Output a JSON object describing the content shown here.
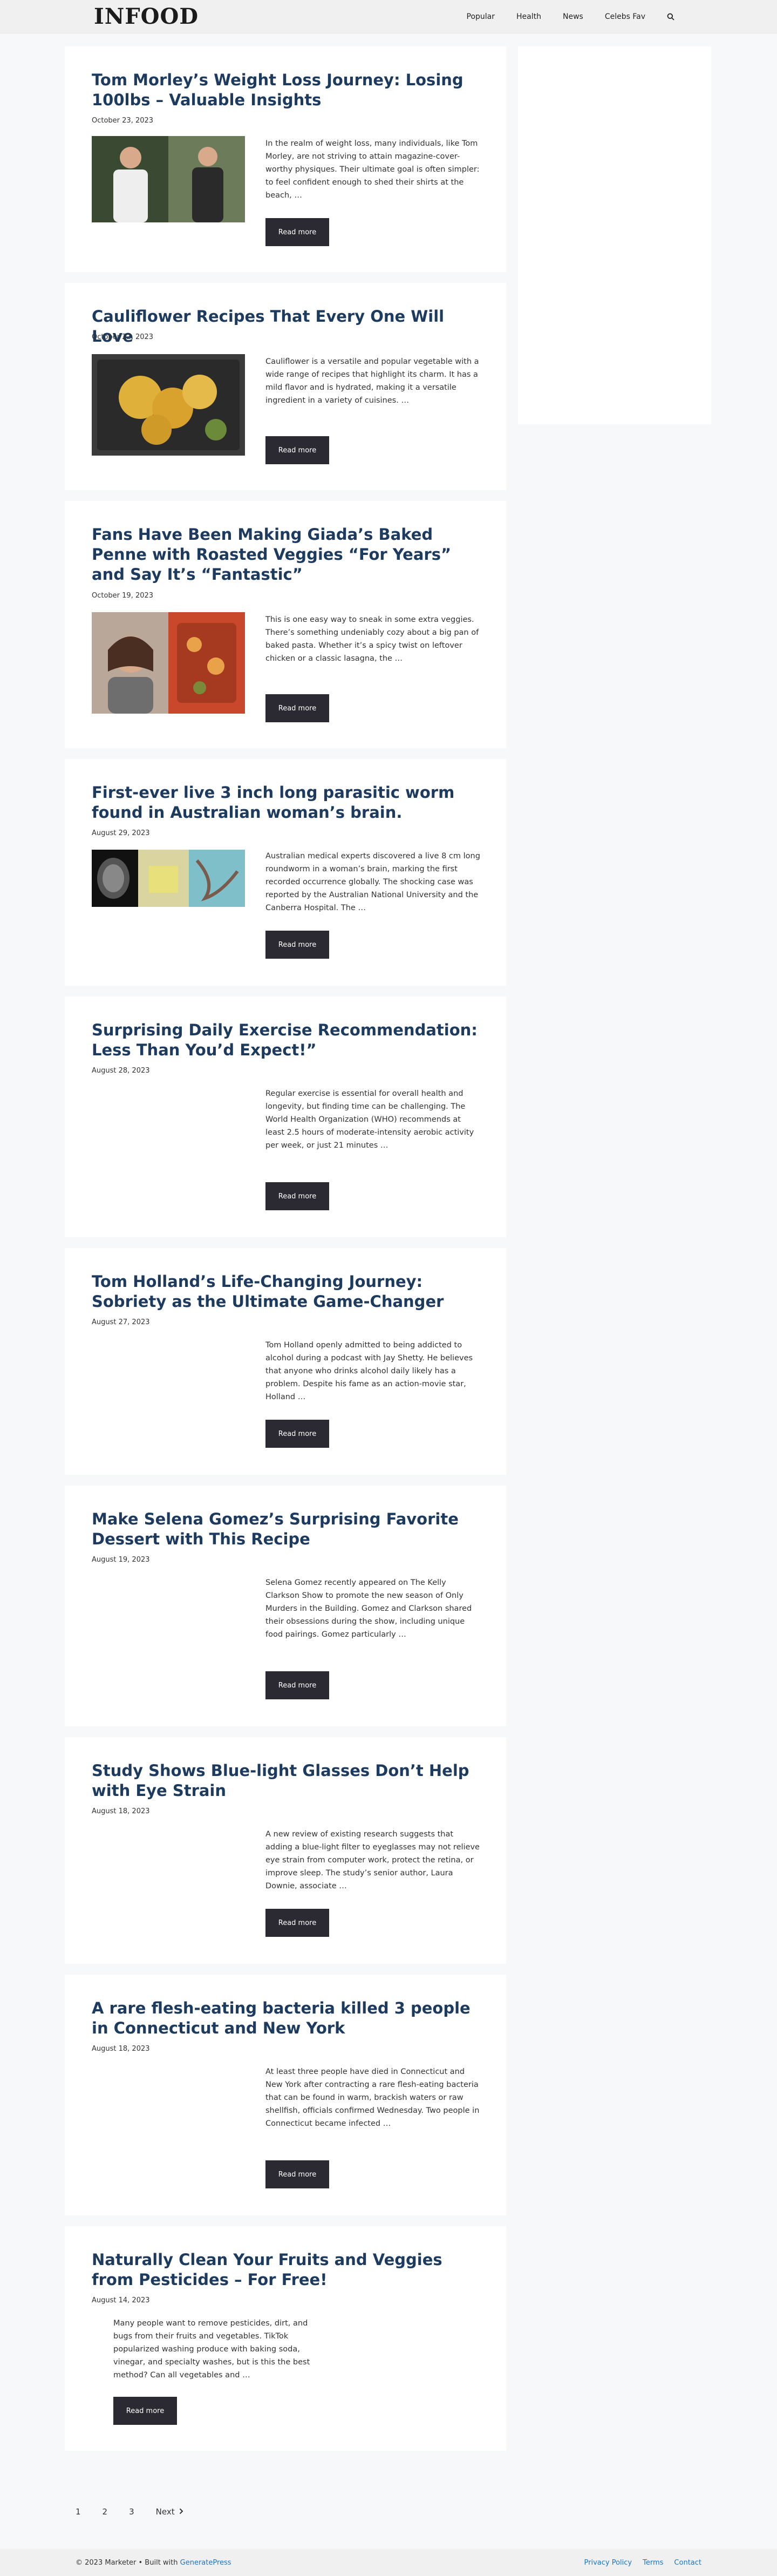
{
  "header": {
    "logo": "INFOOD",
    "nav": [
      "Popular",
      "Health",
      "News",
      "Celebs Fav"
    ]
  },
  "articles": [
    {
      "title": "Tom Morley’s Weight Loss Journey: Losing 100lbs – Valuable Insights",
      "date": "October 23, 2023",
      "excerpt": "In the realm of weight loss, many individuals, like Tom Morley, are not striving to attain magazine-cover-worthy physiques. Their ultimate goal is often simpler: to feel confident enough to shed their shirts at the beach, …",
      "read_more": "Read more"
    },
    {
      "title": "Cauliflower Recipes That Every One Will Love",
      "date": "October 22, 2023",
      "excerpt": "Cauliflower is a versatile and popular vegetable with a wide range of recipes that highlight its charm. It has a mild flavor and is hydrated, making it a versatile ingredient in a variety of cuisines. …",
      "read_more": "Read more"
    },
    {
      "title": "Fans Have Been Making Giada’s Baked Penne with Roasted Veggies “For Years” and Say It’s “Fantastic”",
      "date": "October 19, 2023",
      "excerpt": "This is one easy way to sneak in some extra veggies. There’s something undeniably cozy about a big pan of baked pasta. Whether it’s a spicy twist on leftover chicken or a classic lasagna, the …",
      "read_more": "Read more"
    },
    {
      "title": "First-ever live 3 inch long parasitic worm found in Australian woman’s brain.",
      "date": "August 29, 2023",
      "excerpt": "Australian medical experts discovered a live 8 cm long roundworm in a woman’s brain, marking the first recorded occurrence globally. The shocking case was reported by the Australian National University and the Canberra Hospital. The …",
      "read_more": "Read more"
    },
    {
      "title": "Surprising Daily Exercise Recommendation: Less Than You’d Expect!”",
      "date": "August 28, 2023",
      "excerpt": "Regular exercise is essential for overall health and longevity, but finding time can be challenging. The World Health Organization (WHO) recommends at least 2.5 hours of moderate-intensity aerobic activity per week, or just 21 minutes …",
      "read_more": "Read more"
    },
    {
      "title": "Tom Holland’s Life-Changing Journey: Sobriety as the Ultimate Game-Changer",
      "date": "August 27, 2023",
      "excerpt": "Tom Holland openly admitted to being addicted to alcohol during a podcast with Jay Shetty. He believes that anyone who drinks alcohol daily likely has a problem. Despite his fame as an action-movie star, Holland …",
      "read_more": "Read more"
    },
    {
      "title": "Make Selena Gomez’s Surprising Favorite Dessert with This Recipe",
      "date": "August 19, 2023",
      "excerpt": "Selena Gomez recently appeared on The Kelly Clarkson Show to promote the new season of Only Murders in the Building. Gomez and Clarkson shared their obsessions during the show, including unique food pairings. Gomez particularly …",
      "read_more": "Read more"
    },
    {
      "title": "Study Shows Blue-light Glasses Don’t Help with Eye Strain",
      "date": "August 18, 2023",
      "excerpt": "A new review of existing research suggests that adding a blue-light filter to eyeglasses may not relieve eye strain from computer work, protect the retina, or improve sleep. The study’s senior author, Laura Downie, associate …",
      "read_more": "Read more"
    },
    {
      "title": "A rare flesh-eating bacteria killed 3 people in Connecticut and New York",
      "date": "August 18, 2023",
      "excerpt": "At least three people have died in Connecticut and New York after contracting a rare flesh-eating bacteria that can be found in warm, brackish waters or raw shellfish, officials confirmed Wednesday. Two people in Connecticut became infected …",
      "read_more": "Read more"
    },
    {
      "title": "Naturally Clean Your Fruits and Veggies from Pesticides – For Free!",
      "date": "August 14, 2023",
      "excerpt": "Many people want to remove pesticides, dirt, and bugs from their fruits and vegetables. TikTok popularized washing produce with baking soda, vinegar, and specialty washes, but is this the best method? Can all vegetables and …",
      "read_more": "Read more"
    }
  ],
  "pagination": {
    "pages": [
      "1",
      "2",
      "3"
    ],
    "next": "Next"
  },
  "footer": {
    "copyright": "© 2023 Marketer • Built with ",
    "builder": "GeneratePress",
    "links": [
      "Privacy Policy",
      "Terms",
      "Contact"
    ]
  }
}
